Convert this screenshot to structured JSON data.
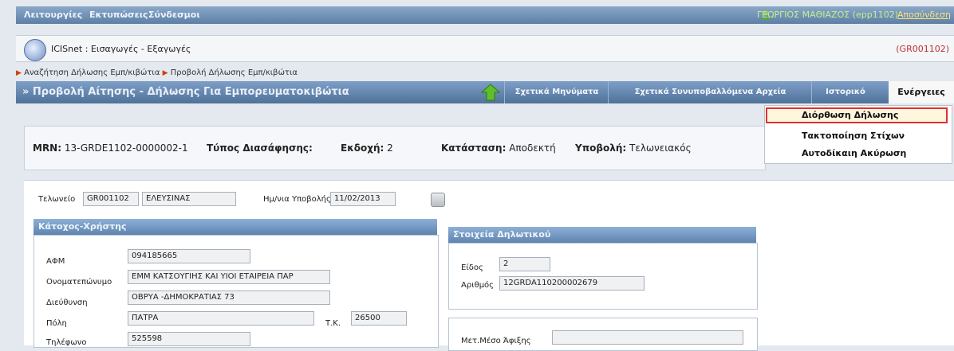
{
  "topbar": {
    "menu": [
      "Λειτουργίες",
      "Εκτυπώσεις",
      "Σύνδεσμοι"
    ],
    "user": "ΓΕΩΡΓΙΟΣ ΜΑΘΙΑΖΟΣ (epp1102)",
    "logout": "Αποσύνδεση"
  },
  "app": {
    "title": "ICISnet : Εισαγωγές - Εξαγωγές",
    "office_code": "(GR001102)"
  },
  "breadcrumb": [
    "Αναζήτηση Δήλωσης Εμπ/κιβώτια",
    "Προβολή Δήλωσης Εμπ/κιβώτια"
  ],
  "section": {
    "title": "» Προβολή Αίτησης - Δήλωσης Για Εμπορευματοκιβώτια",
    "buttons": [
      "Σχετικά Μηνύματα",
      "Σχετικά Συνυποβαλλόμενα Αρχεία",
      "Ιστορικό",
      "Ενέργειες"
    ]
  },
  "actions_menu": [
    "Διόρθωση Δήλωσης",
    "Τακτοποίηση Στίχων",
    "Αυτοδίκαιη Ακύρωση"
  ],
  "summary": {
    "mrn_label": "MRN:",
    "mrn": "13-GRDE1102-0000002-1",
    "type_label": "Τύπος Διασάφησης:",
    "version_label": "Εκδοχή:",
    "version": "2",
    "status_label": "Κατάσταση:",
    "status": "Αποδεκτή",
    "submission_label": "Υποβολή:",
    "submission": "Τελωνειακός"
  },
  "form": {
    "customs_label": "Τελωνείο",
    "customs_code": "GR001102",
    "customs_name": "ΕΛΕΥΣΙΝΑΣ",
    "date_label": "Ημ/νια Υποβολής",
    "date": "11/02/2013",
    "holder_title": "Κάτοχος-Χρήστης",
    "afm_label": "ΑΦΜ",
    "afm": "094185665",
    "name_label": "Ονοματεπώνυμο",
    "name": "ΕΜΜ ΚΑΤΣΟΥΓΙΗΣ ΚΑΙ ΥΙΟΙ ΕΤΑΙΡΕΙΑ ΠΑΡ",
    "address_label": "Διεύθυνση",
    "address": "ΟΒΡΥΑ -ΔΗΜΟΚΡΑΤΙΑΣ 73",
    "city_label": "Πόλη",
    "city": "ΠΑΤΡΑ",
    "tk_label": "Τ.Κ.",
    "tk": "26500",
    "phone_label": "Τηλέφωνο",
    "phone": "525598",
    "decl_title": "Στοιχεία Δηλωτικού",
    "kind_label": "Είδος",
    "kind": "2",
    "number_label": "Αριθμός",
    "number": "12GRDA110200002679",
    "transport_label": "Μετ.Μέσο Άφιξης"
  }
}
